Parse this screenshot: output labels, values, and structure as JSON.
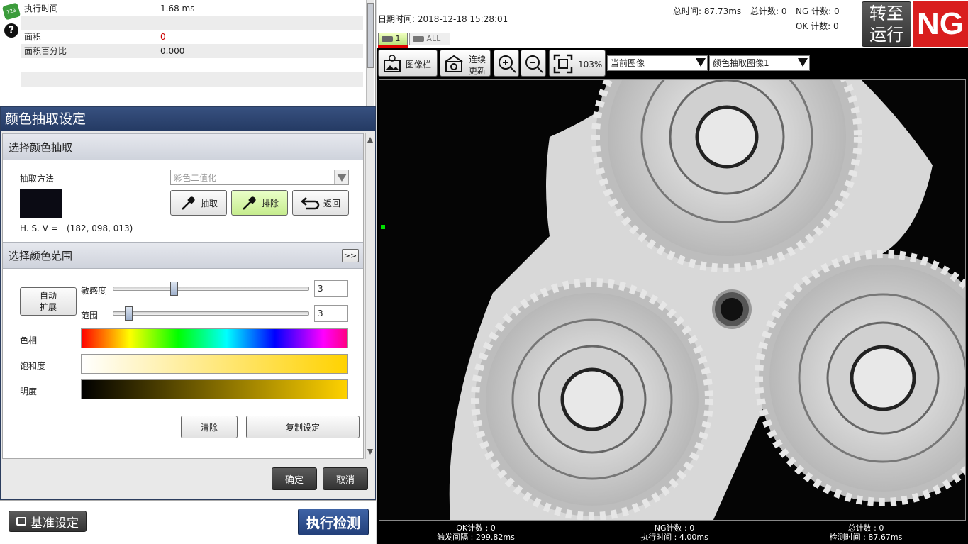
{
  "params": {
    "rows": [
      {
        "key": "执行时间",
        "value": "1.68 ms",
        "color": "#222222"
      },
      {
        "key": "",
        "value": "",
        "color": "#222222"
      },
      {
        "key": "面积",
        "value": "0",
        "color": "#cc0000"
      },
      {
        "key": "面积百分比",
        "value": "0.000",
        "color": "#222222"
      },
      {
        "key": "",
        "value": "",
        "color": "#222222"
      },
      {
        "key": "",
        "value": "",
        "color": "#222222"
      },
      {
        "key": "",
        "value": "",
        "color": "#222222"
      }
    ]
  },
  "dialog": {
    "title": "颜色抽取设定",
    "section1": {
      "title": "选择颜色抽取",
      "method_label": "抽取方法",
      "method_value": "彩色二值化",
      "swatch_color": "#0b0b14",
      "hsv_label": "H. S. V =",
      "hsv_value": "(182, 098, 013)",
      "extract_label": "抽取",
      "exclude_label": "排除",
      "back_label": "返回"
    },
    "section2": {
      "title": "选择颜色范围",
      "expand_label": ">>",
      "auto_expand_label_1": "自动",
      "auto_expand_label_2": "扩展",
      "sensitivity_label": "敏感度",
      "sensitivity_value": "3",
      "range_label": "范围",
      "range_value": "3",
      "hue_label": "色相",
      "saturation_label": "饱和度",
      "brightness_label": "明度",
      "clear_label": "清除",
      "copy_label": "复制设定"
    },
    "ok_label": "确定",
    "cancel_label": "取消"
  },
  "bottom": {
    "base_setting_label": "基准设定",
    "run_label": "执行检测"
  },
  "info": {
    "datetime_label": "日期时间: 2018-12-18 15:28:01",
    "total_time": "总时间: 87.73ms",
    "total_count": "总计数: 0",
    "ng_count": "NG 计数: 0",
    "ok_count": "OK 计数: 0",
    "tab_1": "1",
    "tab_all": "ALL",
    "switch_run_1": "转至",
    "switch_run_2": "运行",
    "result": "NG",
    "result_color": "#d91e1e"
  },
  "toolbar": {
    "image_bar_label": "图像栏",
    "continuous_1": "连续",
    "continuous_2": "更新",
    "zoom_level": "103%",
    "current_image": "当前图像",
    "extract_image": "颜色抽取图像1"
  },
  "stats": {
    "ok_count": "OK计数 : 0",
    "trigger_interval": "触发间隔 : 299.82ms",
    "ng_count": "NG计数 : 0",
    "exec_time": "执行时间 : 4.00ms",
    "total_count": "总计数 : 0",
    "detect_time": "检测时间 : 87.67ms"
  }
}
